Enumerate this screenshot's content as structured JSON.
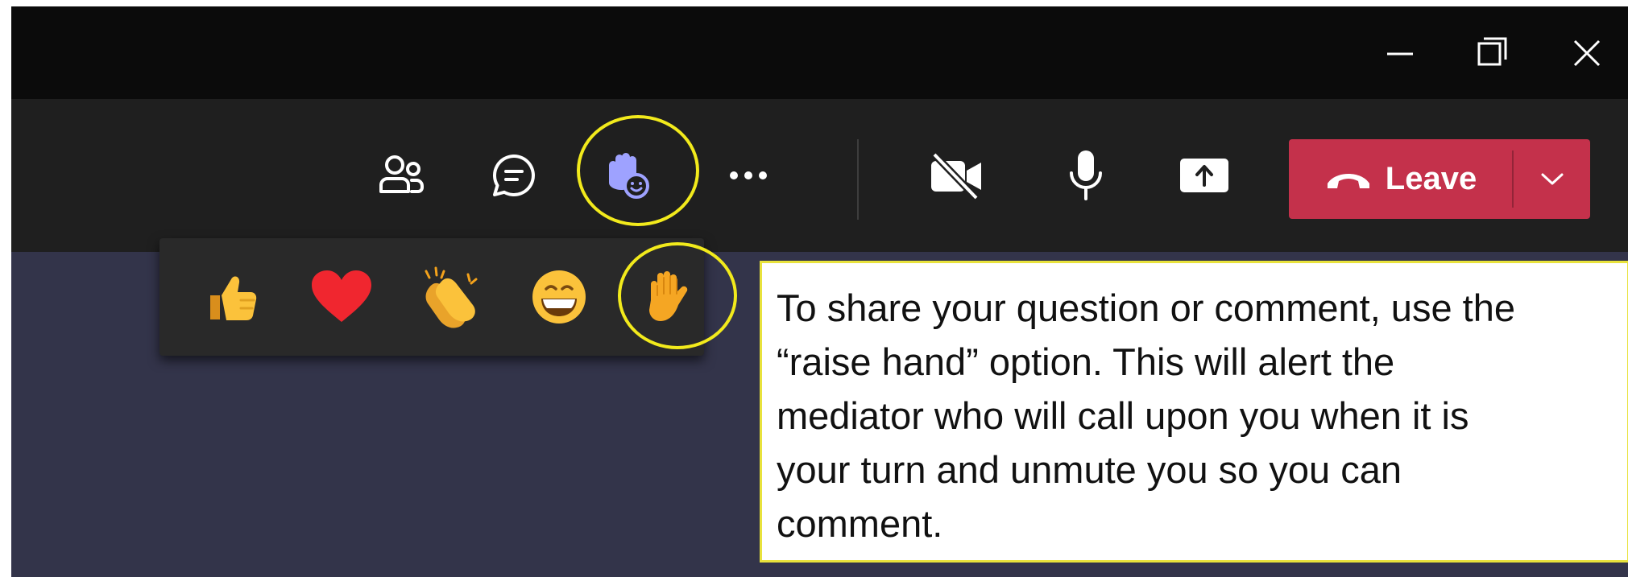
{
  "window_controls": {
    "minimize_icon": "minimize-icon",
    "maximize_icon": "restore-icon",
    "close_icon": "close-icon"
  },
  "toolbar": {
    "buttons": [
      {
        "name": "participants",
        "icon": "people-icon"
      },
      {
        "name": "chat",
        "icon": "chat-icon"
      },
      {
        "name": "reactions",
        "icon": "raise-hand-reactions-icon",
        "accent": "#9ea2ff",
        "highlighted": true
      },
      {
        "name": "more-actions",
        "icon": "more-icon"
      },
      {
        "name": "camera",
        "icon": "camera-off-icon"
      },
      {
        "name": "mic",
        "icon": "microphone-icon"
      },
      {
        "name": "share",
        "icon": "share-screen-icon"
      }
    ],
    "leave": {
      "label": "Leave",
      "color": "#c4314b",
      "icon": "hang-up-icon",
      "menu_icon": "chevron-down-icon"
    }
  },
  "reactions_popup": {
    "items": [
      {
        "name": "like",
        "icon": "thumbs-up-icon"
      },
      {
        "name": "heart",
        "icon": "heart-icon"
      },
      {
        "name": "applause",
        "icon": "clapping-hands-icon"
      },
      {
        "name": "laugh",
        "icon": "laughing-face-icon"
      },
      {
        "name": "raise-hand",
        "icon": "raised-hand-icon",
        "highlighted": true
      }
    ]
  },
  "highlight_color": "#f2ea1c",
  "callout": {
    "text": "To share your question or comment, use the\n“raise hand” option. This will alert the\nmediator who will call upon you when it is\nyour turn and unmute you so you can\ncomment."
  }
}
